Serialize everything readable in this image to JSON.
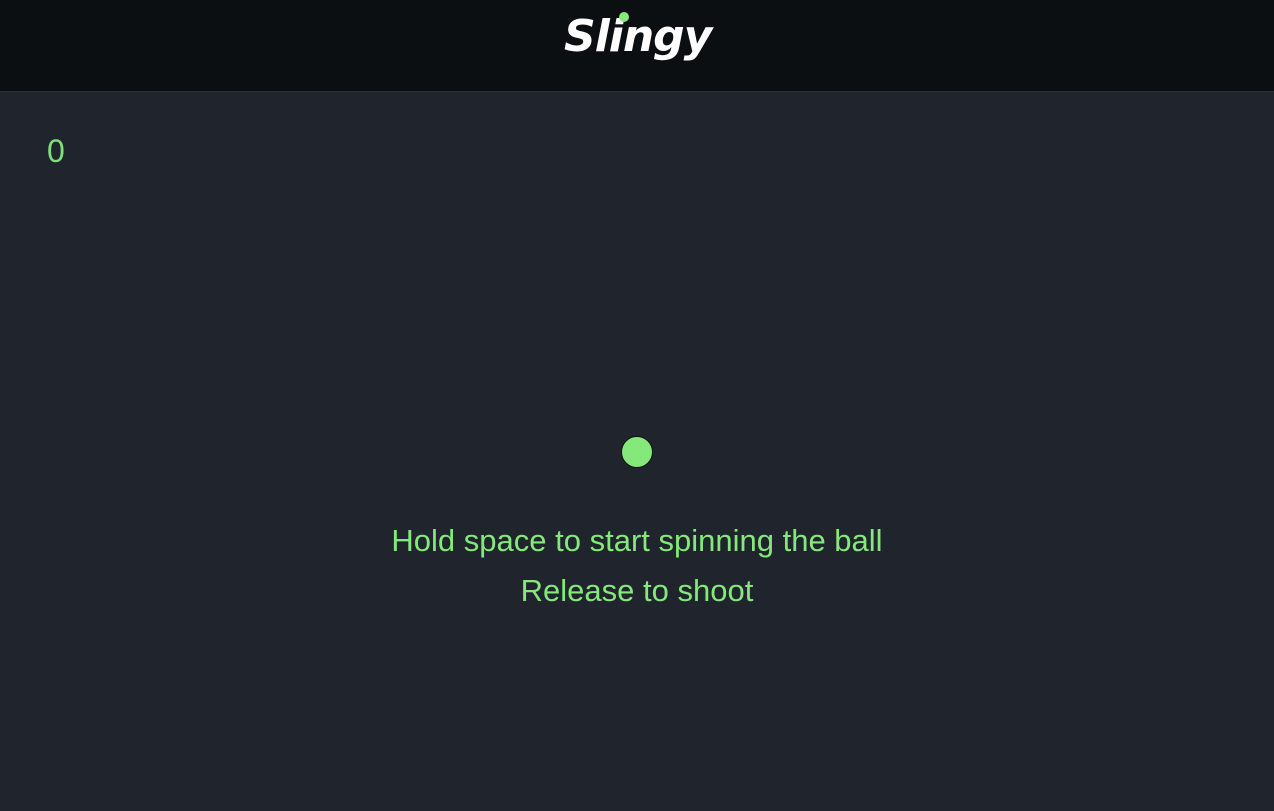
{
  "header": {
    "logo_text": "Slingy"
  },
  "game": {
    "score": "0",
    "ball_color": "#84e87b",
    "instructions": [
      "Hold space to start spinning the ball",
      "Release to shoot"
    ]
  },
  "colors": {
    "background": "#20242c",
    "header_background": "#0c0f11",
    "accent": "#84e87b"
  }
}
